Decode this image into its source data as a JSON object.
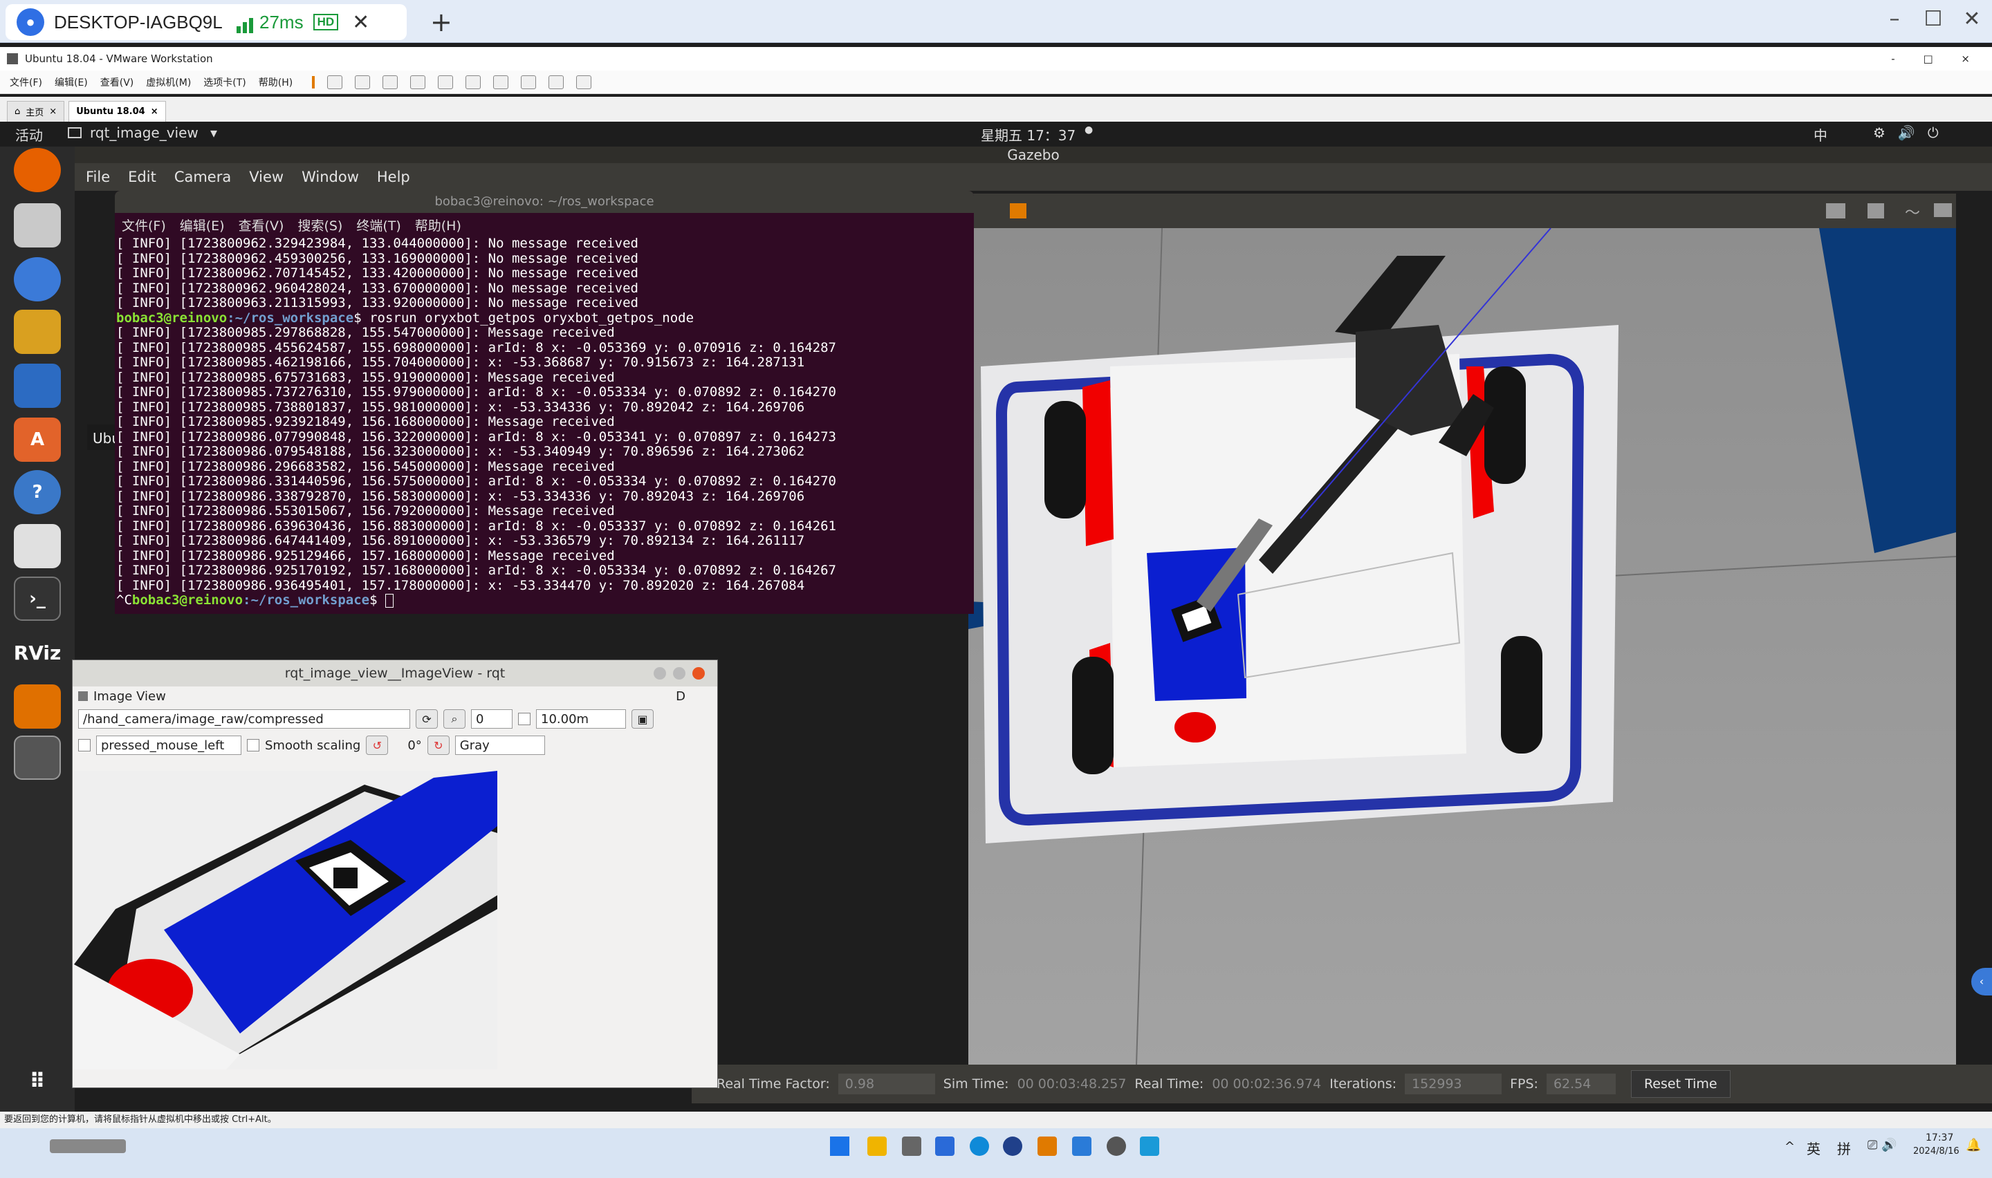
{
  "remote": {
    "host": "DESKTOP-IAGBQ9L",
    "latency": "27ms",
    "quality": "HD"
  },
  "vmware": {
    "title": "Ubuntu 18.04 - VMware Workstation",
    "menu": [
      "文件(F)",
      "编辑(E)",
      "查看(V)",
      "虚拟机(M)",
      "选项卡(T)",
      "帮助(H)"
    ],
    "tabs": [
      "主页",
      "Ubuntu 18.04"
    ],
    "status": "要返回到您的计算机，请将鼠标指针从虚拟机中移出或按 Ctrl+Alt。"
  },
  "ubuntu": {
    "activities": "活动",
    "app": "rqt_image_view",
    "clock": "星期五 17：37",
    "ime": "中"
  },
  "dock": {
    "tooltip": "Ubuntu 软件",
    "rviz": "RViz"
  },
  "gazebo": {
    "title": "Gazebo",
    "menu": [
      "File",
      "Edit",
      "Camera",
      "View",
      "Window",
      "Help"
    ],
    "footer": {
      "rtf_label": "Real Time Factor:",
      "rtf": "0.98",
      "sim_label": "Sim Time:",
      "sim": "00 00:03:48.257",
      "real_label": "Real Time:",
      "real": "00 00:02:36.974",
      "iter_label": "Iterations:",
      "iter": "152993",
      "fps_label": "FPS:",
      "fps": "62.54",
      "reset": "Reset Time"
    }
  },
  "terminal": {
    "title": "bobac3@reinovo: ~/ros_workspace",
    "menu": [
      "文件(F)",
      "编辑(E)",
      "查看(V)",
      "搜索(S)",
      "终端(T)",
      "帮助(H)"
    ],
    "lines": [
      "[ INFO] [1723800962.329423984, 133.044000000]: No message received",
      "[ INFO] [1723800962.459300256, 133.169000000]: No message received",
      "[ INFO] [1723800962.707145452, 133.420000000]: No message received",
      "[ INFO] [1723800962.960428024, 133.670000000]: No message received",
      "[ INFO] [1723800963.211315993, 133.920000000]: No message received"
    ],
    "prompt_user": "bobac3@reinovo",
    "prompt_path": ":~/ros_workspace",
    "command": "$ rosrun oryxbot_getpos oryxbot_getpos_node",
    "lines2": [
      "[ INFO] [1723800985.297868828, 155.547000000]: Message received",
      "[ INFO] [1723800985.455624587, 155.698000000]: arId: 8 x: -0.053369 y: 0.070916 z: 0.164287",
      "[ INFO] [1723800985.462198166, 155.704000000]: x: -53.368687 y: 70.915673 z: 164.287131",
      "[ INFO] [1723800985.675731683, 155.919000000]: Message received",
      "[ INFO] [1723800985.737276310, 155.979000000]: arId: 8 x: -0.053334 y: 0.070892 z: 0.164270",
      "[ INFO] [1723800985.738801837, 155.981000000]: x: -53.334336 y: 70.892042 z: 164.269706",
      "[ INFO] [1723800985.923921849, 156.168000000]: Message received",
      "[ INFO] [1723800986.077990848, 156.322000000]: arId: 8 x: -0.053341 y: 0.070897 z: 0.164273",
      "[ INFO] [1723800986.079548188, 156.323000000]: x: -53.340949 y: 70.896596 z: 164.273062",
      "[ INFO] [1723800986.296683582, 156.545000000]: Message received",
      "[ INFO] [1723800986.331440596, 156.575000000]: arId: 8 x: -0.053334 y: 0.070892 z: 0.164270",
      "[ INFO] [1723800986.338792870, 156.583000000]: x: -53.334336 y: 70.892043 z: 164.269706",
      "[ INFO] [1723800986.553015067, 156.792000000]: Message received",
      "[ INFO] [1723800986.639630436, 156.883000000]: arId: 8 x: -0.053337 y: 0.070892 z: 0.164261",
      "[ INFO] [1723800986.647441409, 156.891000000]: x: -53.336579 y: 70.892134 z: 164.261117",
      "[ INFO] [1723800986.925129466, 157.168000000]: Message received",
      "[ INFO] [1723800986.925170192, 157.168000000]: arId: 8 x: -0.053334 y: 0.070892 z: 0.164267",
      "[ INFO] [1723800986.936495401, 157.178000000]: x: -53.334470 y: 70.892020 z: 164.267084"
    ],
    "final_prefix": "^C"
  },
  "rqt": {
    "title": "rqt_image_view__ImageView - rqt",
    "panel": "Image View",
    "panel_controls": "D",
    "topic": "/hand_camera/image_raw/compressed",
    "spin": "0",
    "dist": "10.00m",
    "mouse_topic": "pressed_mouse_left",
    "smooth": "Smooth scaling",
    "rotation": "0°",
    "colormap": "Gray"
  },
  "taskbar": {
    "lang": "英",
    "ime2": "拼",
    "time": "17:37",
    "date": "2024/8/16"
  },
  "colors": {
    "terminal_bg": "#300a24",
    "prompt_green": "#8ae234",
    "prompt_blue": "#729fcf",
    "gazebo_panel": "#3c3b37"
  }
}
